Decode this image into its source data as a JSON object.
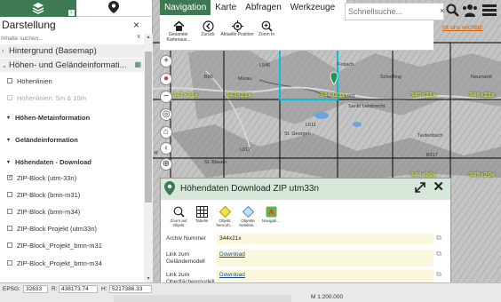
{
  "left_panel": {
    "tabs": [
      {
        "name": "layers-tab",
        "icon": "layers-icon",
        "badge": "1"
      },
      {
        "name": "location-tab",
        "icon": "location-pin-icon"
      }
    ],
    "title": "Darstellung",
    "close": "×",
    "search_placeholder": "Inhalte suchen...",
    "search_clear": "x",
    "groups": [
      {
        "label": "Hintergrund (Basemap)",
        "chev": "›"
      },
      {
        "label": "Höhen- und Geländeinformati...",
        "chev": "⌄"
      }
    ],
    "items": [
      {
        "label": "Höhenlinien",
        "checked": false,
        "disabled": false
      },
      {
        "label": "Höhenlinien: 5m & 10m",
        "checked": false,
        "disabled": true
      },
      {
        "label": "Höhen-Metainformation",
        "arrow": "▾"
      },
      {
        "label": "Geländeinformation",
        "arrow": "▾"
      },
      {
        "label": "Höhendaten - Download",
        "arrow": "▾"
      },
      {
        "label": "ZIP-Block (utm-33n)",
        "checked": true
      },
      {
        "label": "ZIP-Block (bmn-m31)",
        "checked": false
      },
      {
        "label": "ZIP-Block (bmn-m34)",
        "checked": false
      },
      {
        "label": "ZIP-Block Projekt (utm33n)",
        "checked": false
      },
      {
        "label": "ZIP-Block_Projekt_bmn-m31",
        "checked": false
      },
      {
        "label": "ZIP-Block_Projekt_bmn-m34",
        "checked": false
      }
    ],
    "check_mark": "✓"
  },
  "navbar": {
    "tabs": [
      "Navigation",
      "Karte",
      "Abfragen",
      "Werkzeuge"
    ],
    "tools": [
      {
        "label": "Gesamter Kartenausschnitt",
        "short": "Gesamter Kartenaus...",
        "icon": "home-icon"
      },
      {
        "label": "Zurück",
        "icon": "back-arrow-icon"
      },
      {
        "label": "Aktuelle Position",
        "icon": "crosshair-icon"
      },
      {
        "label": "Zoom In",
        "icon": "zoom-in-icon"
      }
    ]
  },
  "quick_search": {
    "placeholder": "Schnellsuche...",
    "clear": "×",
    "hint": "ist uns wichtig!"
  },
  "map": {
    "grid_labels": [
      "343x21x",
      "344x21x",
      "345x21x",
      "346x21x",
      "347x21x",
      "344x20x",
      "345x20x"
    ],
    "towns": [
      "Murau",
      "Sankt Lambrecht",
      "Neumarkt",
      "St. Georgen",
      "Scheifling",
      "Frojach",
      "St. Blasen",
      "Teufenbach"
    ],
    "roads": [
      "L546",
      "L501",
      "B96",
      "B317",
      "L612",
      "L611"
    ],
    "map_controls": [
      "+",
      "−",
      "◎",
      "⌂",
      "‹",
      "⊕"
    ],
    "collapse": "«",
    "watermark": "mark"
  },
  "popup": {
    "title": "Höhendaten Download ZIP utm33n",
    "close": "✕",
    "tools": [
      {
        "label": "Zoom auf Objekt",
        "icon": "zoom-to-object-icon"
      },
      {
        "label": "Tabelle",
        "icon": "table-icon"
      },
      {
        "label": "Objekt hervorh...",
        "icon": "highlight-object-icon"
      },
      {
        "label": "Objekte Selektie...",
        "icon": "select-objects-icon"
      },
      {
        "label": "Navigati...",
        "icon": "navigation-icon"
      }
    ],
    "attributes": [
      {
        "key": "Archiv Nummer",
        "value": "344x21x",
        "link": false
      },
      {
        "key": "Link zum Geländemodell",
        "value": "Download",
        "link": true
      },
      {
        "key": "Link zum Oberflächenmodell",
        "value": "Download",
        "link": true
      }
    ],
    "copy_icon": "⧉"
  },
  "statusbar": {
    "epsg_label": "EPSG:",
    "epsg": "32633",
    "r_label": "R:",
    "r": "438173.74",
    "h_label": "H:",
    "h": "5217386.33",
    "scale": "M 1:200.000"
  }
}
